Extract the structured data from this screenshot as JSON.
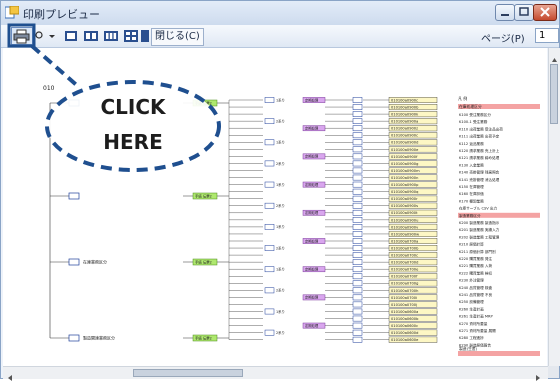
{
  "window": {
    "title": "印刷プレビュー",
    "close_label": "閉じる(C)",
    "page_label": "ページ(P)",
    "page_value": "1"
  },
  "overlay": {
    "line1": "CLICK",
    "line2": "HERE"
  },
  "doc": {
    "level1": [
      "010"
    ],
    "groups": [
      "在庫業務区分",
      "製造関連業務区分"
    ],
    "tag_green": "手続 伝票2",
    "tag_purple": "定期処理",
    "sub_label": "1系り",
    "sub_label2": "2系り",
    "codes": [
      "010100a0900c",
      "010100a0900b",
      "010100a0900k",
      "010100a0900a",
      "010100a0900z",
      "010100a0900c",
      "010100a0900d",
      "010100a0900e",
      "010100a0900f",
      "010100a0900g",
      "010100a0900m",
      "010100a0900n",
      "010100a0900p",
      "010100a0900q",
      "010100a0900r",
      "010100a0900s",
      "010100a0900t",
      "010100a0900u",
      "010100a0900v",
      "010100a0900w",
      "010100a0700a",
      "010100a0700b",
      "010100a0700c",
      "010100a0700d",
      "010100a0700e",
      "010100a0700f",
      "010100a0700g",
      "010100a0700h",
      "010100a0700i",
      "010100a0700j",
      "010100a0600a",
      "010100a0600b",
      "010100a0600c",
      "010100a0600d",
      "010100a0600e"
    ],
    "legend_header": "凡 例",
    "legend_header2": "在庫処理区分",
    "legend_header3": "製造(生産)",
    "legend_items": [
      "K100 受注業務区分",
      "K100-1 受注業務",
      "K110 出荷業務 受注品出荷",
      "K111 出荷業務 出荷予定",
      "K112 返品業務",
      "K120 請求業務 売上計上",
      "K121 請求業務 締め処理",
      "K130 入金業務",
      "K140 売掛管理 残高照会",
      "K141 売掛管理 消込処理",
      "K150 在庫管理",
      "K160 在庫評価",
      "K170 棚卸業務",
      "在庫サーブル CSV 出力",
      "製造業務区分",
      "K200 製造業務 製造指示",
      "K201 製造業務 実績入力",
      "K202 製造業務 工程管理",
      "K210 原価計算",
      "K211 原価計算 部門別",
      "K220 購買業務 発注",
      "K221 購買業務 入荷",
      "K222 購買業務 検収",
      "K230 外注管理",
      "K240 品質管理 検査",
      "K241 品質管理 不良",
      "K250 設備管理",
      "K260 生産計画",
      "K261 生産計画 MRP",
      "K270 資材所要量",
      "K271 資材所要量 展開",
      "K280 工程進捗",
      "K290 製造原価報告"
    ]
  }
}
